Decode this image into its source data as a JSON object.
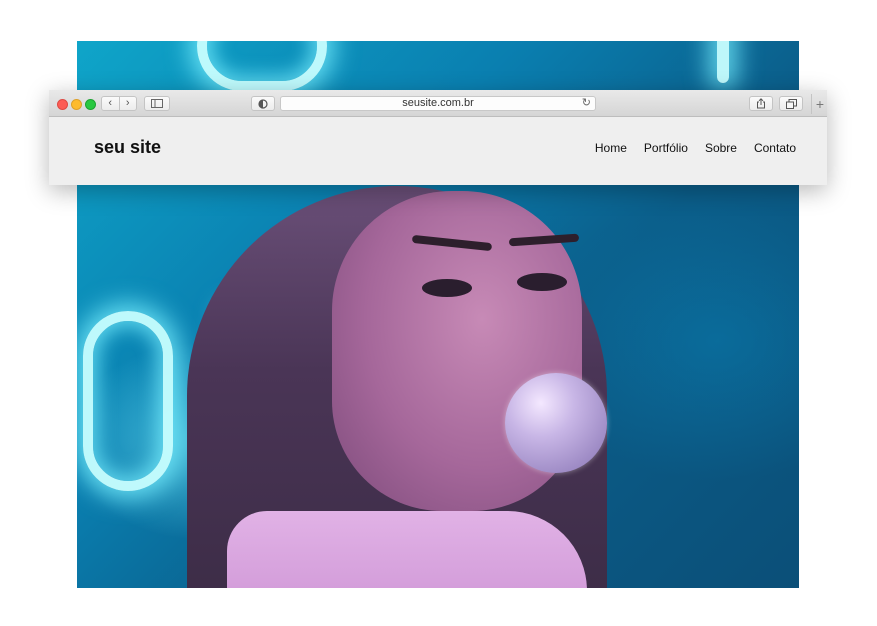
{
  "browser": {
    "url": "seusite.com.br",
    "nav_back": "‹",
    "nav_forward": "›",
    "new_tab": "+"
  },
  "site": {
    "logo": "seu site",
    "nav": [
      "Home",
      "Portfólio",
      "Sobre",
      "Contato"
    ]
  },
  "icons": {
    "close": "close-dot-icon",
    "minimize": "minimize-dot-icon",
    "zoom": "zoom-dot-icon",
    "sidebar": "sidebar-icon",
    "privacy": "shield-icon",
    "reload": "reload-icon",
    "share": "share-icon",
    "tabs": "tabs-overview-icon"
  },
  "colors": {
    "close": "#fc5d56",
    "minimize": "#fdbb2e",
    "zoom": "#29c841"
  }
}
